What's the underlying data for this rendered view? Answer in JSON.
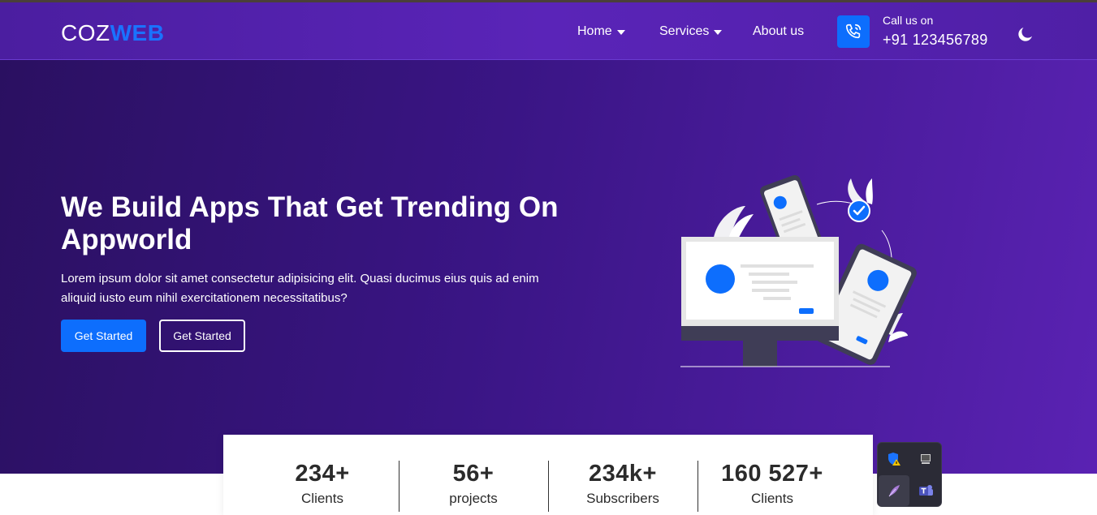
{
  "brand": {
    "logo_part1": "COZ",
    "logo_part2": "WEB",
    "accent_color": "#1a73ff"
  },
  "nav": {
    "items": [
      {
        "label": "Home",
        "has_dropdown": true
      },
      {
        "label": "Services",
        "has_dropdown": true
      },
      {
        "label": "About us",
        "has_dropdown": false
      }
    ],
    "call_label": "Call us on",
    "call_number": "+91 123456789",
    "icons": [
      "phone-icon",
      "moon-icon"
    ]
  },
  "hero": {
    "title": "We Build Apps That Get Trending On Appworld",
    "description": "Lorem ipsum dolor sit amet consectetur adipisicing elit. Quasi ducimus eius quis ad enim aliquid iusto eum nihil exercitationem necessitatibus?",
    "primary_button": "Get Started",
    "secondary_button": "Get Started",
    "colors": {
      "gradient_start": "#2a1060",
      "gradient_end": "#5a22b3",
      "button": "#0d6efd"
    }
  },
  "stats": [
    {
      "value": "234+",
      "label": "Clients"
    },
    {
      "value": "56+",
      "label": "projects"
    },
    {
      "value": "234k+",
      "label": "Subscribers"
    },
    {
      "value": "160 527+",
      "label": "Clients"
    }
  ],
  "tray": {
    "icons": [
      "shield-warning-icon",
      "monitor-icon",
      "feather-icon",
      "teams-icon"
    ]
  }
}
